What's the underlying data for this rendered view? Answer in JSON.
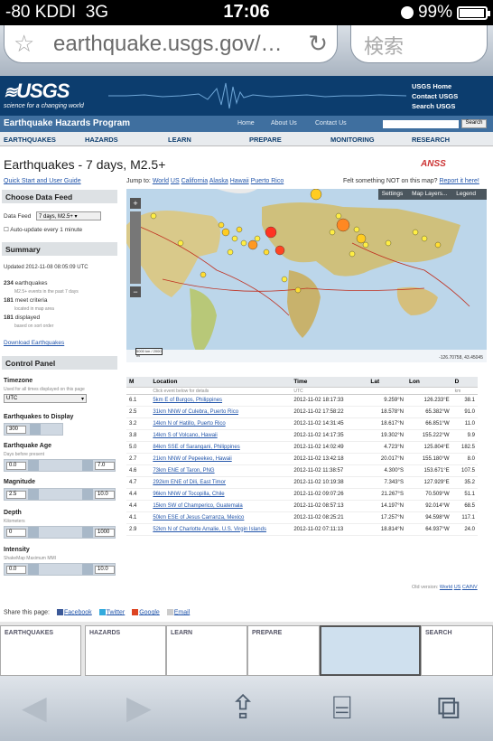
{
  "status": {
    "carrier": "-80 KDDI",
    "network": "3G",
    "time": "17:06",
    "battery": "99%"
  },
  "browser": {
    "url": "earthquake.usgs.gov/…",
    "search_placeholder": "検索"
  },
  "header": {
    "logo": "USGS",
    "tagline": "science for a changing world",
    "links": [
      "USGS Home",
      "Contact USGS",
      "Search USGS"
    ],
    "program": "Earthquake Hazards Program",
    "program_links": [
      "Home",
      "About Us",
      "Contact Us"
    ],
    "search_button": "Search"
  },
  "nav": [
    "EARTHQUAKES",
    "HAZARDS",
    "LEARN",
    "PREPARE",
    "MONITORING",
    "RESEARCH"
  ],
  "page": {
    "title": "Earthquakes - 7 days, M2.5+",
    "anss": "ANSS",
    "quick_start": "Quick Start and User Guide",
    "jump_label": "Jump to:",
    "jump_links": [
      "World",
      "US",
      "California",
      "Alaska",
      "Hawaii",
      "Puerto Rico"
    ],
    "felt_text": "Felt something NOT on this map?",
    "felt_link": "Report it here!"
  },
  "sidebar": {
    "choose_feed": "Choose Data Feed",
    "data_feed_label": "Data Feed",
    "data_feed_value": "7 days, M2.5+",
    "auto_update": "Auto-update every 1 minute",
    "summary_title": "Summary",
    "updated": "Updated 2012-11-08 08:05:09 UTC",
    "earthquakes_count": "234",
    "earthquakes_label": "earthquakes",
    "earthquakes_sub": "M2.5+ events in the past 7 days",
    "meet_count": "181",
    "meet_label": "meet criteria",
    "meet_sub": "located in map area",
    "displayed_count": "181",
    "displayed_label": "displayed",
    "displayed_sub": "based on sort order",
    "download": "Download Earthquakes",
    "control_panel": "Control Panel",
    "timezone_label": "Timezone",
    "timezone_sub": "Used for all times displayed on this page",
    "timezone_value": "UTC",
    "display_label": "Earthquakes to Display",
    "display_value": "300",
    "age_label": "Earthquake Age",
    "age_sub": "Days before present",
    "age_min": "0.0",
    "age_max": "7.0",
    "mag_label": "Magnitude",
    "mag_min": "2.5",
    "mag_max": "10.0",
    "depth_label": "Depth",
    "depth_sub": "Kilometers",
    "depth_min": "0",
    "depth_max": "1000",
    "intensity_label": "Intensity",
    "intensity_sub": "ShakeMap Maximum MMI",
    "int_min": "0.0",
    "int_max": "10.0"
  },
  "map": {
    "toolbar": [
      "Settings",
      "Map Layers...",
      "Legend"
    ],
    "scale": "5000 km / 2000 mi",
    "coords": "-126.70758, 43.45045"
  },
  "table": {
    "headers": [
      "M",
      "Location",
      "Time",
      "Lat",
      "Lon",
      "D"
    ],
    "subheaders": [
      "",
      "Click event below for details",
      "UTC",
      "",
      "",
      "km"
    ],
    "rows": [
      [
        "6.1",
        "5km E of Burgos, Philippines",
        "2012-11-02 18:17:33",
        "9.259°N",
        "126.233°E",
        "38.1"
      ],
      [
        "2.5",
        "31km NNW of Culebra, Puerto Rico",
        "2012-11-02 17:58:22",
        "18.578°N",
        "65.382°W",
        "91.0"
      ],
      [
        "3.2",
        "14km N of Hatillo, Puerto Rico",
        "2012-11-02 14:31:45",
        "18.617°N",
        "66.851°W",
        "11.0"
      ],
      [
        "3.8",
        "14km S of Volcano, Hawaii",
        "2012-11-02 14:17:35",
        "19.302°N",
        "155.222°W",
        "9.9"
      ],
      [
        "5.0",
        "84km SSE of Sarangani, Philippines",
        "2012-11-02 14:02:49",
        "4.723°N",
        "125.804°E",
        "182.5"
      ],
      [
        "2.7",
        "21km NNW of Pepeekeo, Hawaii",
        "2012-11-02 13:42:18",
        "20.017°N",
        "155.180°W",
        "8.0"
      ],
      [
        "4.6",
        "73km ENE of Taron, PNG",
        "2012-11-02 11:38:57",
        "4.300°S",
        "153.671°E",
        "107.5"
      ],
      [
        "4.7",
        "292km ENE of Dili, East Timor",
        "2012-11-02 10:19:38",
        "7.343°S",
        "127.929°E",
        "35.2"
      ],
      [
        "4.4",
        "96km NNW of Tocopilla, Chile",
        "2012-11-02 09:07:26",
        "21.267°S",
        "70.509°W",
        "51.1"
      ],
      [
        "4.4",
        "15km SW of Champerico, Guatemala",
        "2012-11-02 08:57:13",
        "14.197°N",
        "92.014°W",
        "68.5"
      ],
      [
        "4.1",
        "50km ESE of Jesus Carranza, Mexico",
        "2012-11-02 08:25:21",
        "17.257°N",
        "94.598°W",
        "117.1"
      ],
      [
        "2.9",
        "52km N of Charlotte Amalie, U.S. Virgin Islands",
        "2012-11-02 07:11:13",
        "18.814°N",
        "64.937°W",
        "24.0"
      ]
    ]
  },
  "footer": {
    "old_version": "Old version:",
    "old_links": [
      "World",
      "US",
      "CA/NV"
    ],
    "share_label": "Share this page:",
    "share": [
      "Facebook",
      "Twitter",
      "Google",
      "Email"
    ]
  },
  "tabs_preview": [
    "EARTHQUAKES",
    "HAZARDS",
    "LEARN",
    "PREPARE",
    "SEARCH"
  ]
}
